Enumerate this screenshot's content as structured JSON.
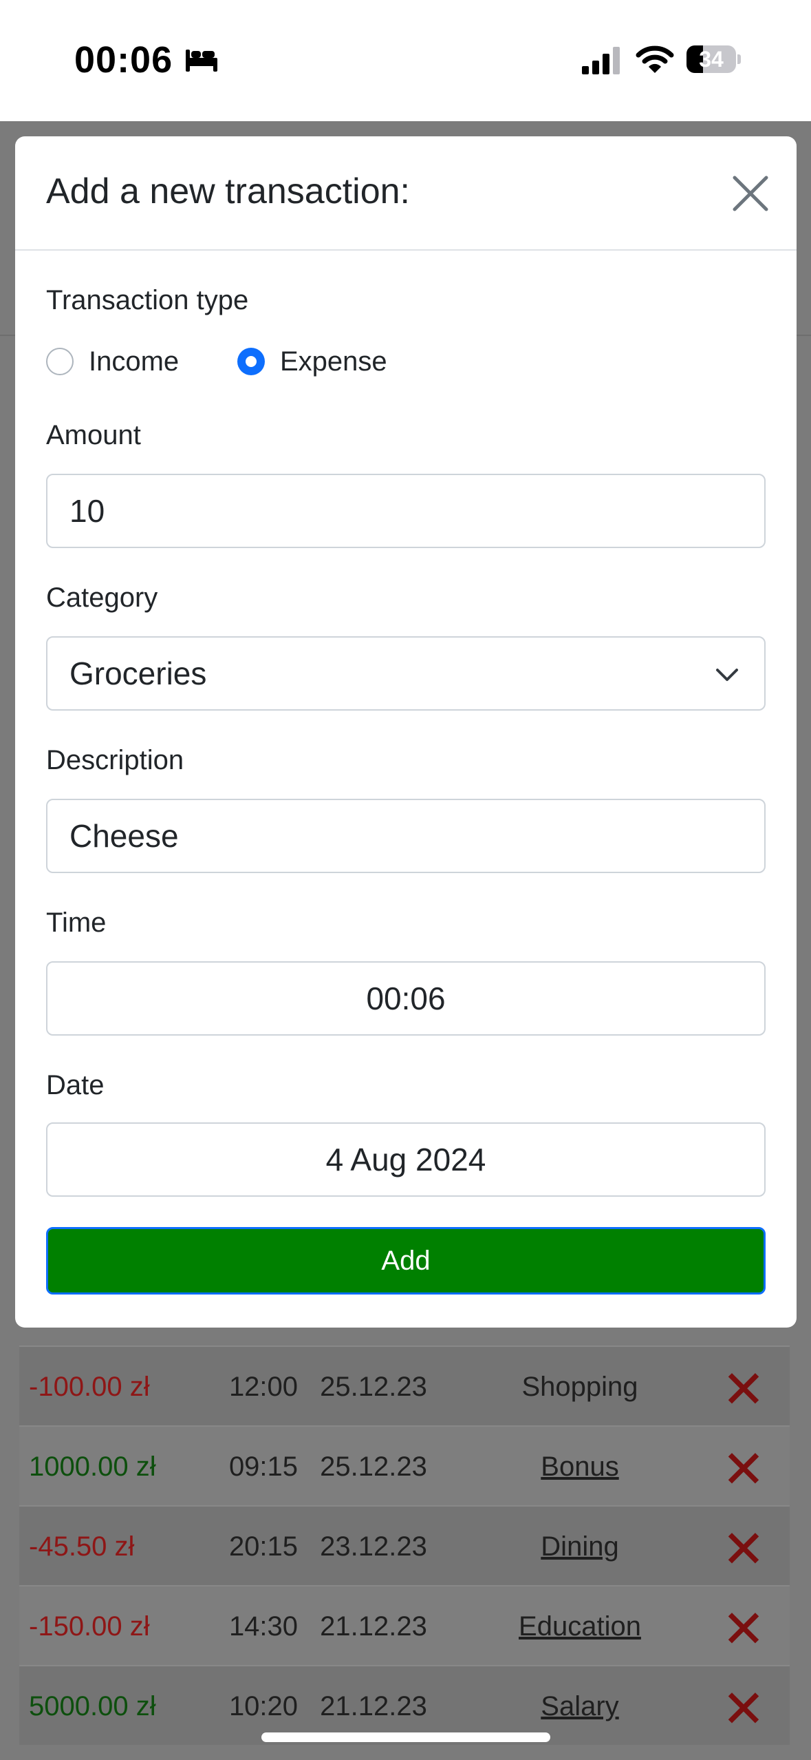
{
  "status_bar": {
    "time": "00:06",
    "battery_level": "34",
    "battery_fraction": 0.34,
    "icons": [
      "sleep-icon",
      "signal-icon",
      "wifi-icon",
      "battery-icon"
    ]
  },
  "modal": {
    "title": "Add a new transaction:",
    "close_icon": "close-icon",
    "transaction_type": {
      "label": "Transaction type",
      "options": [
        {
          "label": "Income",
          "checked": false
        },
        {
          "label": "Expense",
          "checked": true
        }
      ]
    },
    "amount": {
      "label": "Amount",
      "value": "10"
    },
    "category": {
      "label": "Category",
      "value": "Groceries"
    },
    "description": {
      "label": "Description",
      "value": "Cheese"
    },
    "time": {
      "label": "Time",
      "value": "00:06"
    },
    "date": {
      "label": "Date",
      "value": "4 Aug 2024"
    },
    "add_button": "Add"
  },
  "transactions": [
    {
      "amount": "-100.00 zł",
      "time": "12:00",
      "date": "25.12.23",
      "category": "Shopping",
      "type": "expense",
      "link": false
    },
    {
      "amount": "1000.00 zł",
      "time": "09:15",
      "date": "25.12.23",
      "category": "Bonus",
      "type": "income",
      "link": true
    },
    {
      "amount": "-45.50 zł",
      "time": "20:15",
      "date": "23.12.23",
      "category": "Dining",
      "type": "expense",
      "link": true
    },
    {
      "amount": "-150.00 zł",
      "time": "14:30",
      "date": "21.12.23",
      "category": "Education",
      "type": "expense",
      "link": true
    },
    {
      "amount": "5000.00 zł",
      "time": "10:20",
      "date": "21.12.23",
      "category": "Salary",
      "type": "income",
      "link": true
    }
  ],
  "delete_glyph": "✕",
  "colors": {
    "accent": "#0d6efd",
    "add_button": "#008000",
    "expense": "#dc3545",
    "income": "#198754",
    "delete": "#b02a37"
  }
}
